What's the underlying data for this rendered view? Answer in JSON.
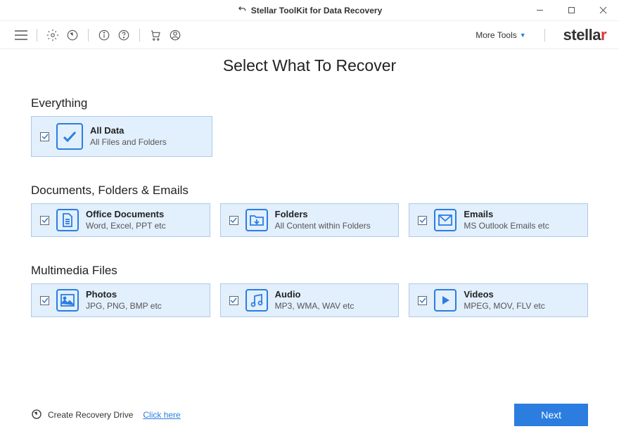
{
  "window": {
    "title": "Stellar ToolKit for Data Recovery"
  },
  "toolbar": {
    "more_tools": "More Tools",
    "logo": "stella",
    "logo_accent": "r"
  },
  "page": {
    "title": "Select What To Recover"
  },
  "sections": {
    "everything": {
      "title": "Everything",
      "card": {
        "title": "All Data",
        "desc": "All Files and Folders"
      }
    },
    "documents": {
      "title": "Documents, Folders & Emails",
      "cards": [
        {
          "title": "Office Documents",
          "desc": "Word, Excel, PPT etc"
        },
        {
          "title": "Folders",
          "desc": "All Content within Folders"
        },
        {
          "title": "Emails",
          "desc": "MS Outlook Emails etc"
        }
      ]
    },
    "multimedia": {
      "title": "Multimedia Files",
      "cards": [
        {
          "title": "Photos",
          "desc": "JPG, PNG, BMP etc"
        },
        {
          "title": "Audio",
          "desc": "MP3, WMA, WAV etc"
        },
        {
          "title": "Videos",
          "desc": "MPEG, MOV, FLV etc"
        }
      ]
    }
  },
  "footer": {
    "recovery_drive": "Create Recovery Drive",
    "click_here": "Click here",
    "next": "Next"
  }
}
